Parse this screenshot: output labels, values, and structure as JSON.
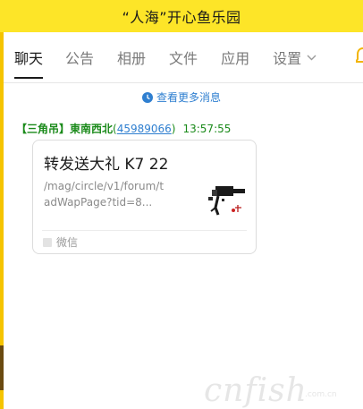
{
  "window": {
    "title": "“人海”开心鱼乐园"
  },
  "tabs": [
    {
      "label": "聊天",
      "active": true
    },
    {
      "label": "公告",
      "active": false
    },
    {
      "label": "相册",
      "active": false
    },
    {
      "label": "文件",
      "active": false
    },
    {
      "label": "应用",
      "active": false
    },
    {
      "label": "设置",
      "active": false,
      "has_dropdown": true
    }
  ],
  "history": {
    "label": "查看更多消息",
    "icon": "clock-icon"
  },
  "message": {
    "tag": "【三角吊】",
    "sender": "東南西北",
    "qq_open": "(",
    "qq": "45989066",
    "qq_close": ")",
    "time": "13:57:55"
  },
  "card": {
    "title": "转发送大礼 K7 22",
    "desc_line1": "/mag/circle/v1/forum/thre",
    "desc_line2": "adWapPage?tid=8...",
    "source": "微信",
    "thumb_icon": "kite-reel-icon"
  },
  "watermark": {
    "text": "cnfish",
    "sub": ".com.cn"
  },
  "colors": {
    "titlebar": "#fde528",
    "accent_blue": "#2f7fd0",
    "sender_green": "#1a8a1a"
  }
}
